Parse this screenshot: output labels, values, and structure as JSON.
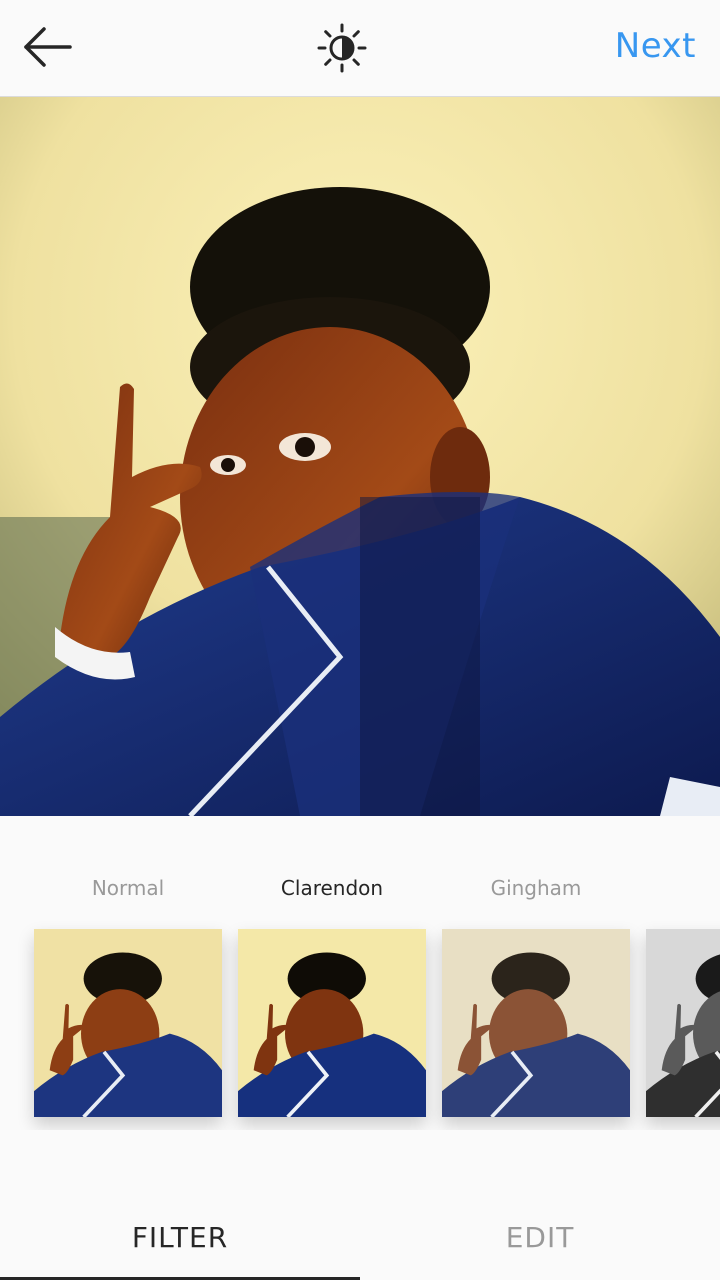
{
  "header": {
    "back_icon": "arrow-left-icon",
    "lux_icon": "brightness-contrast-icon",
    "next_label": "Next",
    "accent_color": "#3897f0"
  },
  "photo": {
    "description_icon": "photo-preview"
  },
  "filters": {
    "items": [
      {
        "label": "Normal",
        "active": false
      },
      {
        "label": "Clarendon",
        "active": true
      },
      {
        "label": "Gingham",
        "active": false
      },
      {
        "label": "",
        "active": false
      }
    ]
  },
  "tabs": {
    "filter_label": "FILTER",
    "edit_label": "EDIT",
    "active": "FILTER"
  }
}
